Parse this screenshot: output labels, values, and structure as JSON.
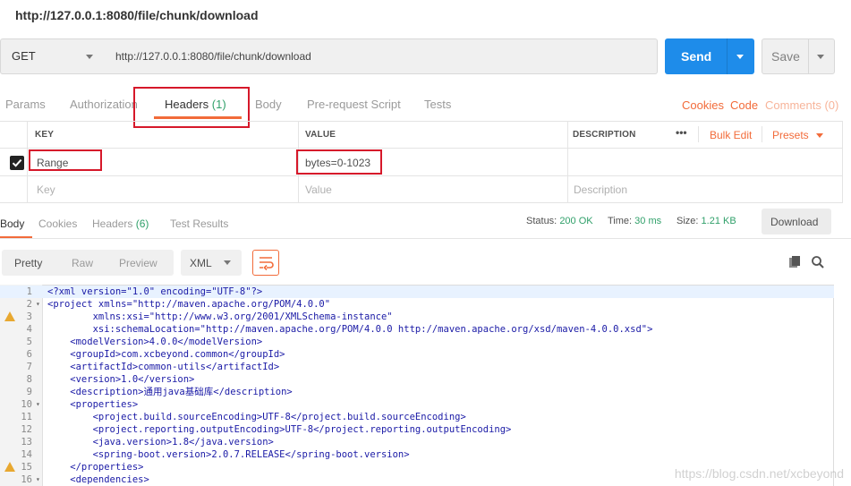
{
  "request": {
    "title": "http://127.0.0.1:8080/file/chunk/download",
    "method": "GET",
    "url": "http://127.0.0.1:8080/file/chunk/download",
    "send_label": "Send",
    "save_label": "Save"
  },
  "request_tabs": {
    "params": "Params",
    "authorization": "Authorization",
    "headers": "Headers",
    "headers_count": "(1)",
    "body": "Body",
    "prerequest": "Pre-request Script",
    "tests": "Tests",
    "cookies": "Cookies",
    "code": "Code",
    "comments": "Comments (0)"
  },
  "headers_table": {
    "col_key": "KEY",
    "col_value": "VALUE",
    "col_description": "DESCRIPTION",
    "more": "•••",
    "bulk_edit": "Bulk Edit",
    "presets": "Presets",
    "rows": [
      {
        "key": "Range",
        "value": "bytes=0-1023",
        "checked": true
      }
    ],
    "placeholder": {
      "key": "Key",
      "value": "Value",
      "description": "Description"
    }
  },
  "response_tabs": {
    "body": "Body",
    "cookies": "Cookies",
    "headers": "Headers",
    "headers_count": "(6)",
    "test_results": "Test Results"
  },
  "response_meta": {
    "status_label": "Status:",
    "status": "200 OK",
    "time_label": "Time:",
    "time": "30 ms",
    "size_label": "Size:",
    "size": "1.21 KB",
    "download": "Download"
  },
  "format_bar": {
    "pretty": "Pretty",
    "raw": "Raw",
    "preview": "Preview",
    "format": "XML"
  },
  "code_lines": [
    {
      "n": "1",
      "text": "<?xml version=\"1.0\" encoding=\"UTF-8\"?>",
      "fold": false,
      "warn": false
    },
    {
      "n": "2",
      "text": "<project xmlns=\"http://maven.apache.org/POM/4.0.0\"",
      "fold": true,
      "warn": false
    },
    {
      "n": "3",
      "text": "        xmlns:xsi=\"http://www.w3.org/2001/XMLSchema-instance\"",
      "fold": false,
      "warn": true
    },
    {
      "n": "4",
      "text": "        xsi:schemaLocation=\"http://maven.apache.org/POM/4.0.0 http://maven.apache.org/xsd/maven-4.0.0.xsd\">",
      "fold": false,
      "warn": false
    },
    {
      "n": "5",
      "text": "    <modelVersion>4.0.0</modelVersion>",
      "fold": false,
      "warn": false
    },
    {
      "n": "6",
      "text": "    <groupId>com.xcbeyond.common</groupId>",
      "fold": false,
      "warn": false
    },
    {
      "n": "7",
      "text": "    <artifactId>common-utils</artifactId>",
      "fold": false,
      "warn": false
    },
    {
      "n": "8",
      "text": "    <version>1.0</version>",
      "fold": false,
      "warn": false
    },
    {
      "n": "9",
      "text": "    <description>通用java基础库</description>",
      "fold": false,
      "warn": false
    },
    {
      "n": "10",
      "text": "    <properties>",
      "fold": true,
      "warn": false
    },
    {
      "n": "11",
      "text": "        <project.build.sourceEncoding>UTF-8</project.build.sourceEncoding>",
      "fold": false,
      "warn": false
    },
    {
      "n": "12",
      "text": "        <project.reporting.outputEncoding>UTF-8</project.reporting.outputEncoding>",
      "fold": false,
      "warn": false
    },
    {
      "n": "13",
      "text": "        <java.version>1.8</java.version>",
      "fold": false,
      "warn": false
    },
    {
      "n": "14",
      "text": "        <spring-boot.version>2.0.7.RELEASE</spring-boot.version>",
      "fold": false,
      "warn": false
    },
    {
      "n": "15",
      "text": "    </properties>",
      "fold": false,
      "warn": true
    },
    {
      "n": "16",
      "text": "    <dependencies>",
      "fold": true,
      "warn": false
    }
  ],
  "watermark": "https://blog.csdn.net/xcbeyond"
}
